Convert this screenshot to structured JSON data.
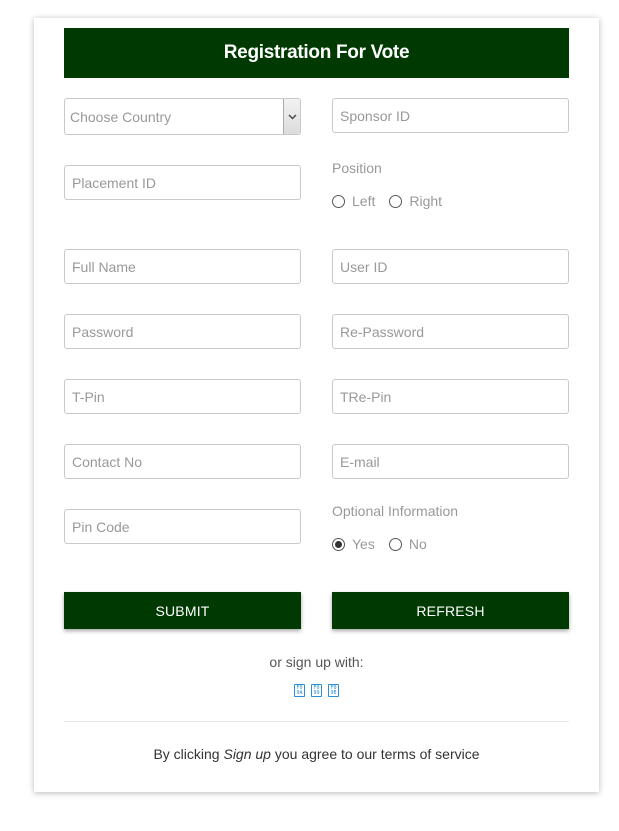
{
  "header": {
    "title": "Registration For Vote"
  },
  "form": {
    "country_select": "Choose Country",
    "sponsor_id": "Sponsor ID",
    "placement_id": "Placement ID",
    "position_label": "Position",
    "position_options": [
      "Left",
      "Right"
    ],
    "position_selected": null,
    "full_name": "Full Name",
    "user_id": "User ID",
    "password": "Password",
    "re_password": "Re-Password",
    "t_pin": "T-Pin",
    "tre_pin": "TRe-Pin",
    "contact_no": "Contact No",
    "email": "E-mail",
    "pin_code": "Pin Code",
    "optional_label": "Optional Information",
    "optional_options": [
      "Yes",
      "No"
    ],
    "optional_selected": "Yes"
  },
  "buttons": {
    "submit": "SUBMIT",
    "refresh": "REFRESH"
  },
  "social": {
    "prompt": "or sign up with:",
    "icons": [
      "social-icon-1",
      "social-icon-2",
      "social-icon-3"
    ]
  },
  "footer": {
    "prefix": "By clicking",
    "emphasis": "Sign up",
    "middle": "you agree to our",
    "link": "terms of service"
  },
  "colors": {
    "primary": "#003a02",
    "placeholder": "#999999",
    "border": "#c9c9c9"
  }
}
